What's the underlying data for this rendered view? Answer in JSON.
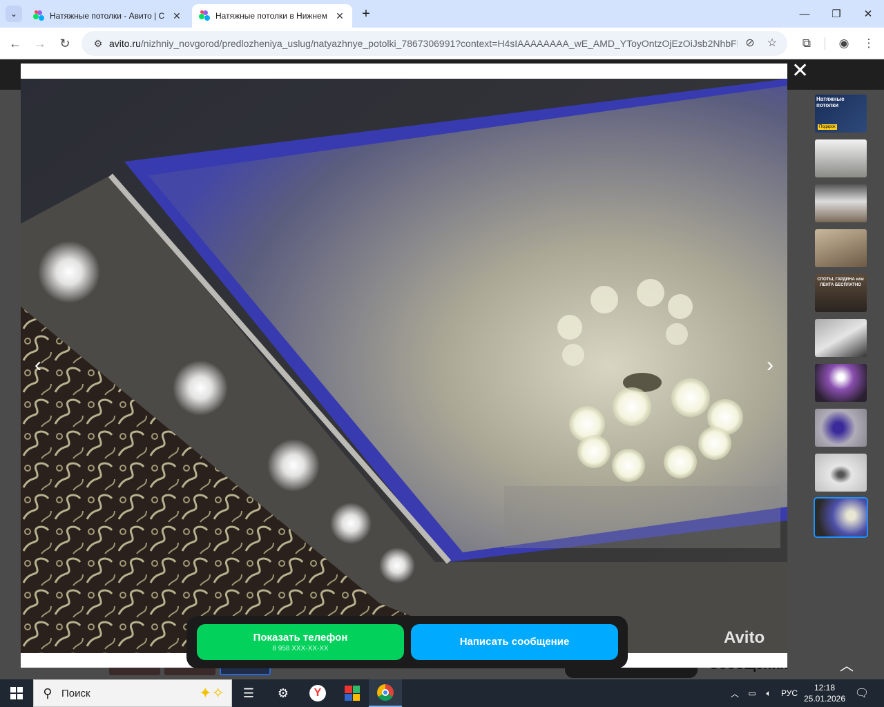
{
  "browser": {
    "tabs": [
      {
        "title": "Натяжные потолки - Авито | С",
        "active": false
      },
      {
        "title": "Натяжные потолки в Нижнем",
        "active": true
      }
    ],
    "address_host": "avito.ru",
    "address_path": "/nizhniy_novgorod/predlozheniya_uslug/natyazhnye_potolki_7867306991?context=H4sIAAAAAAAA_wE_AMD_YToyOntzOjEzOiJsb2NhbFB..."
  },
  "gallery": {
    "watermark": "Avito",
    "thumbnails": [
      {
        "caption": "Натяжные потолки",
        "badge": "Подарок",
        "active": false
      },
      {
        "caption": "",
        "active": false
      },
      {
        "caption": "",
        "active": false
      },
      {
        "caption": "",
        "active": false
      },
      {
        "caption": "СПОТЫ, ГАРДИНА или ЛЕНТА БЕСПЛАТНО",
        "active": false
      },
      {
        "caption": "",
        "active": false
      },
      {
        "caption": "",
        "active": false
      },
      {
        "caption": "",
        "active": false
      },
      {
        "caption": "",
        "active": false
      },
      {
        "caption": "",
        "active": true
      }
    ]
  },
  "contact": {
    "phone_label": "Показать телефон",
    "phone_masked": "8 958 XXX-XX-XX",
    "message_label": "Написать сообщение"
  },
  "page_behind": {
    "messages_label": "Сообщения"
  },
  "taskbar": {
    "search_label": "Поиск",
    "language": "РУС",
    "time": "12:18",
    "date": "25.01.2026"
  },
  "colors": {
    "tabbar": "#d3e3fd",
    "phone_button": "#02d15c",
    "message_button": "#00aaff",
    "taskbar": "#1f2732"
  }
}
